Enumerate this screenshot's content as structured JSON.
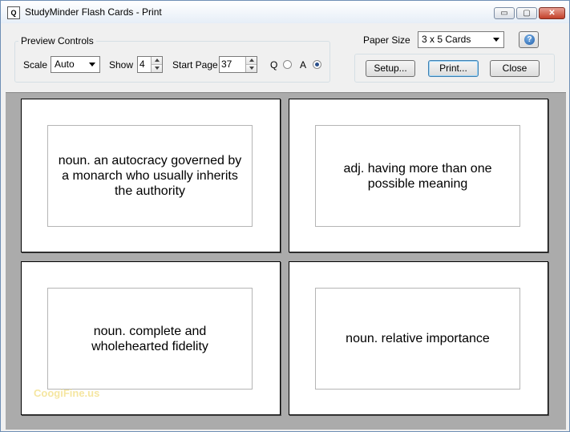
{
  "window": {
    "title": "StudyMinder Flash Cards - Print",
    "icon_name": "magnifier-app-icon",
    "min_symbol": "▭",
    "max_symbol": "▢",
    "close_symbol": "✕"
  },
  "preview_controls": {
    "group_title": "Preview Controls",
    "scale_label": "Scale",
    "scale_value": "Auto",
    "show_label": "Show",
    "show_value": "4",
    "start_page_label": "Start Page",
    "start_page_value": "37",
    "radio_q_label": "Q",
    "radio_a_label": "A",
    "selected_side": "A"
  },
  "paper": {
    "label": "Paper Size",
    "value": "3 x 5 Cards",
    "help_symbol": "?"
  },
  "buttons": {
    "setup": "Setup...",
    "print": "Print...",
    "close": "Close"
  },
  "cards": [
    "noun. an autocracy governed by a monarch who usually inherits the authority",
    "adj. having more than one possible meaning",
    "noun. complete and wholehearted fidelity",
    "noun. relative importance"
  ],
  "watermark": "CoogiFine.us"
}
